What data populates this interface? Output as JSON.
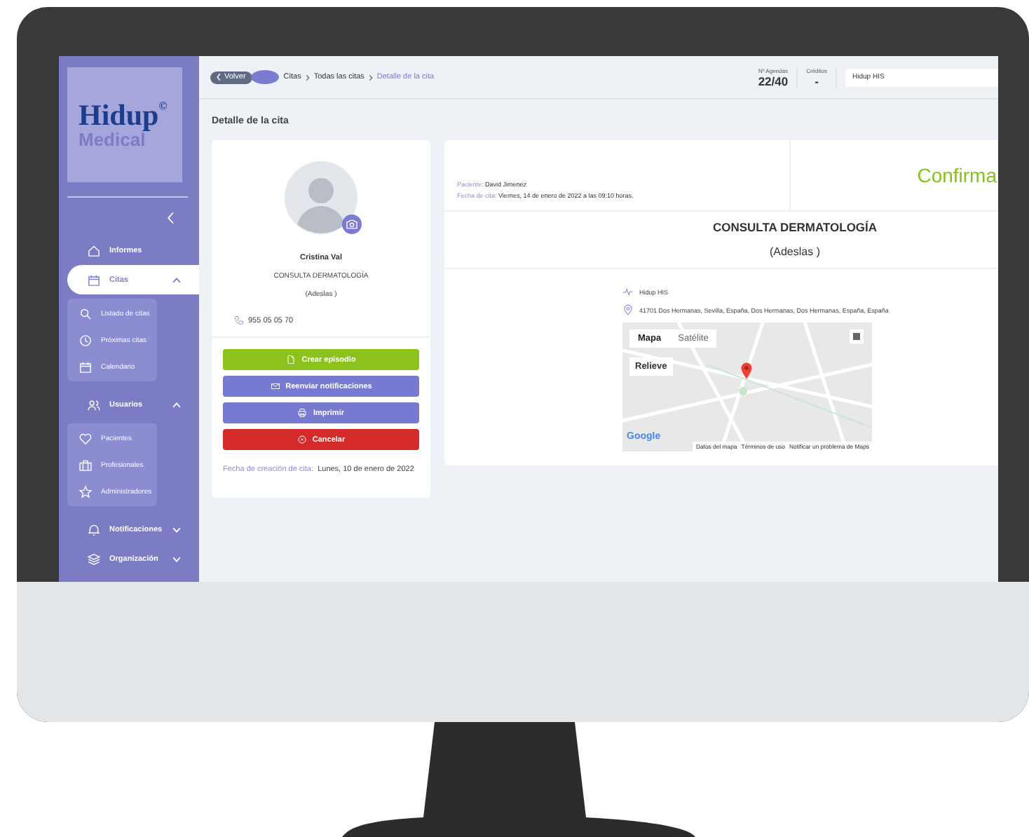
{
  "sidebar": {
    "logo": {
      "name": "Hidup",
      "mark": "©",
      "subtitle": "Medical"
    },
    "items": [
      {
        "label": "Informes",
        "kind": "link",
        "selected": false
      },
      {
        "label": "Citas",
        "kind": "group",
        "selected": true,
        "expanded": true,
        "children": [
          {
            "label": "Listado de citas",
            "selected": false
          },
          {
            "label": "Próximas citas",
            "selected": false
          },
          {
            "label": "Calendario",
            "selected": false
          }
        ]
      },
      {
        "label": "Usuarios",
        "kind": "group",
        "selected": false,
        "expanded": true,
        "children": [
          {
            "label": "Pacientes",
            "selected": false
          },
          {
            "label": "Profesionales",
            "selected": false
          },
          {
            "label": "Administradores",
            "selected": false
          }
        ]
      },
      {
        "label": "Notificaciones",
        "kind": "group",
        "selected": false,
        "expanded": false
      },
      {
        "label": "Organización",
        "kind": "group",
        "selected": false,
        "expanded": false
      }
    ]
  },
  "topbar": {
    "back_button": "Volver",
    "breadcrumb": [
      {
        "label": "Citas",
        "selected": false
      },
      {
        "label": "Todas las citas",
        "selected": false
      },
      {
        "label": "Detalle de la cita",
        "selected": true
      }
    ],
    "stats": [
      {
        "label": "Nº Agendas",
        "value": "22/40"
      },
      {
        "label": "Créditos",
        "value": "-"
      }
    ],
    "center_select": "Hidup HIS"
  },
  "page_title": "Detalle de la cita",
  "professional": {
    "name": "Cristina Val",
    "service": "CONSULTA DERMATOLOGÍA",
    "insurer": "(Adeslas )",
    "phone": "955 05 05 70",
    "buttons": [
      {
        "label": "Crear episodio",
        "kind": "create"
      },
      {
        "label": "Reenviar notificaciones",
        "kind": "resend"
      },
      {
        "label": "Imprimir",
        "kind": "print"
      },
      {
        "label": "Cancelar",
        "kind": "cancel"
      }
    ],
    "created_label": "Fecha de creación de cita:",
    "created_value": "Lunes, 10 de enero de 2022"
  },
  "appointment": {
    "patient_label": "Paciente:",
    "patient": "David Jimenez",
    "date_label": "Fecha de cita:",
    "date": "Viernes, 14 de enero de 2022 a las 09:10 horas.",
    "status": "Confirma",
    "service": "CONSULTA DERMATOLOGÍA",
    "insurer": "(Adeslas )",
    "center": "Hidup HIS",
    "address": "41701 Dos Hermanas, Sevilla, España, Dos Hermanas, Dos Hermanas, España, España",
    "map": {
      "tabs": [
        {
          "label": "Mapa",
          "selected": true
        },
        {
          "label": "Satélite",
          "selected": false
        }
      ],
      "terrain": "Relieve",
      "logo": "Google",
      "footer": [
        "Datos del mapa",
        "Términos de uso",
        "Notificar un problema de Maps"
      ]
    }
  }
}
